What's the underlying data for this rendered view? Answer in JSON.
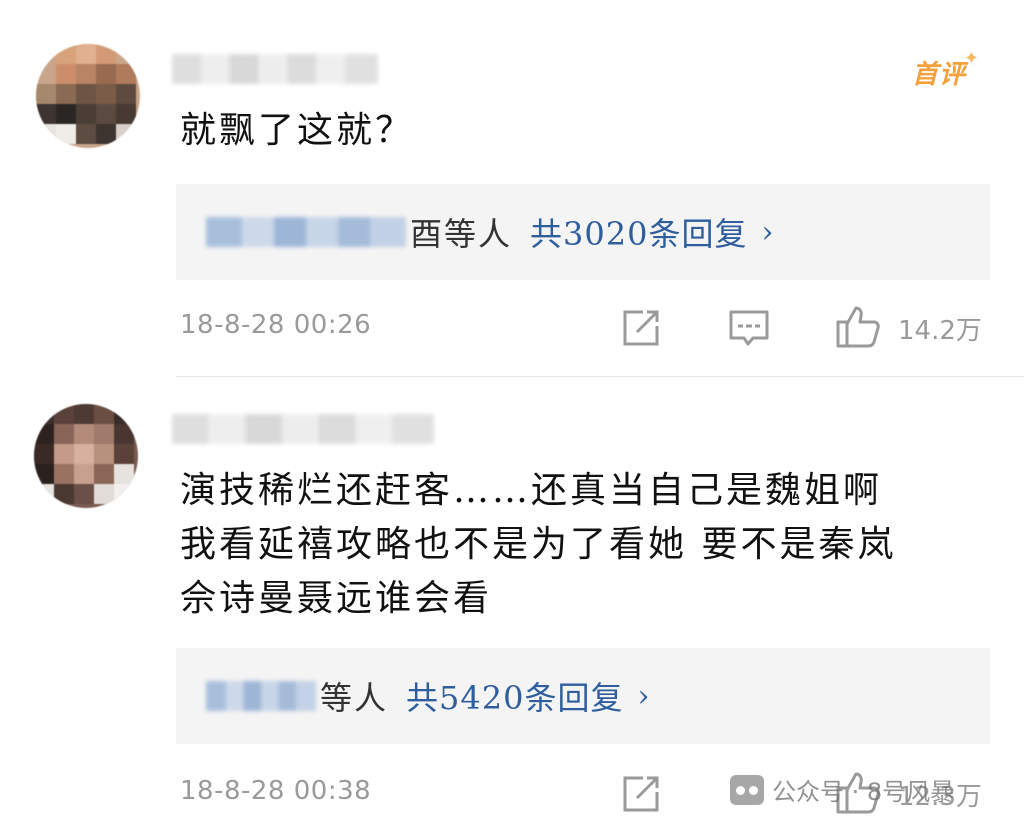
{
  "comments": [
    {
      "badge": "首评",
      "text": "就飘了这就？",
      "reply_suffix": "酉等人",
      "reply_count": "共3020条回复",
      "reply_arrow": "›",
      "timestamp": "18-8-28 00:26",
      "likes": "14.2万"
    },
    {
      "text": "演技稀烂还赶客……还真当自己是魏姐啊\n我看延禧攻略也不是为了看她 要不是秦岚\n佘诗曼聂远谁会看",
      "reply_suffix": "等人",
      "reply_count": "共5420条回复",
      "reply_arrow": "›",
      "timestamp": "18-8-28 00:38",
      "likes": "12.3万"
    }
  ],
  "watermark": {
    "text": "公众号 · 8号风暴"
  },
  "icons": {
    "share": "share-icon",
    "comment": "comment-icon",
    "like": "thumbs-up-icon"
  },
  "colors": {
    "link_blue": "#2f5e9e",
    "badge_orange": "#f5a03a",
    "meta_gray": "#9a9a9a",
    "reply_bg": "#f4f4f4"
  }
}
